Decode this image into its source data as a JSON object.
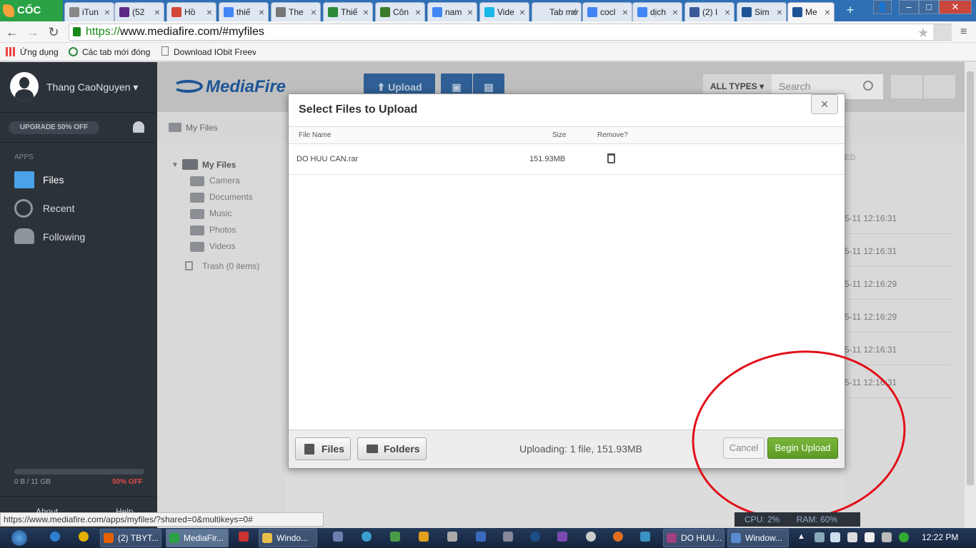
{
  "browser": {
    "logo": "CỐC CỐC",
    "tabs": [
      {
        "label": "iTun",
        "color": "#888"
      },
      {
        "label": "(52",
        "color": "#5b2a86"
      },
      {
        "label": "Hồ",
        "color": "#d44638"
      },
      {
        "label": "thiế",
        "color": "#4285f4"
      },
      {
        "label": "The",
        "color": "#777"
      },
      {
        "label": "Thiế",
        "color": "#2a8a3a"
      },
      {
        "label": "Côn",
        "color": "#3a7a2a"
      },
      {
        "label": "nam",
        "color": "#4285f4"
      },
      {
        "label": "Vide",
        "color": "#1ab7ea"
      },
      {
        "label": "Tab mớ",
        "color": "#dfe7f2"
      },
      {
        "label": "cocl",
        "color": "#4285f4"
      },
      {
        "label": "dịch",
        "color": "#4285f4"
      },
      {
        "label": "(2) I",
        "color": "#3b5998"
      },
      {
        "label": "Sim",
        "color": "#1d5496"
      },
      {
        "label": "Me",
        "color": "#1d5496"
      }
    ],
    "url_scheme": "https://",
    "url_rest": "www.mediafire.com/#myfiles",
    "bookmarks": [
      "Ứng dụng",
      "Các tab mới đóng",
      "Download IObit Freev"
    ]
  },
  "sidebar": {
    "user_name": "Thang CaoNguyen",
    "upgrade_label": "UPGRADE 50% OFF",
    "apps_heading": "APPS",
    "items": [
      {
        "label": "Files"
      },
      {
        "label": "Recent"
      },
      {
        "label": "Following"
      }
    ],
    "storage_used": "0 B / 11 GB",
    "storage_offer": "50% OFF",
    "about_label": "About",
    "help_label": "Help"
  },
  "header": {
    "logo": "MediaFire",
    "upload_label": "Upload",
    "types_label": "ALL TYPES",
    "search_placeholder": "Search"
  },
  "breadcrumb": "My Files",
  "tree": {
    "root": "My Files",
    "folders": [
      "Camera",
      "Documents",
      "Music",
      "Photos",
      "Videos"
    ],
    "trash": "Trash (0 items)"
  },
  "list": {
    "col_header": "ED",
    "dates": [
      "5-11 12:16:31",
      "5-11 12:16:31",
      "5-11 12:16:29",
      "5-11 12:16:29",
      "5-11 12:16:31",
      "5-11 12:16:31"
    ]
  },
  "modal": {
    "title": "Select Files to Upload",
    "close": "×",
    "col_name": "File Name",
    "col_size": "Size",
    "col_remove": "Remove?",
    "file_name": "DO HUU CAN.rar",
    "file_size": "151.93MB",
    "files_btn": "Files",
    "folders_btn": "Folders",
    "status": "Uploading: 1 file, 151.93MB",
    "cancel": "Cancel",
    "begin": "Begin Upload"
  },
  "status_url": "https://www.mediafire.com/apps/myfiles/?shared=0&multikeys=0#",
  "monitor": {
    "cpu": "CPU: 2%",
    "ram": "RAM: 60%"
  },
  "taskbar": {
    "items": [
      "(2) TBYT...",
      "MediaFir...",
      "Windo...",
      "DO HUU...",
      "Window..."
    ],
    "clock": "12:22 PM"
  }
}
